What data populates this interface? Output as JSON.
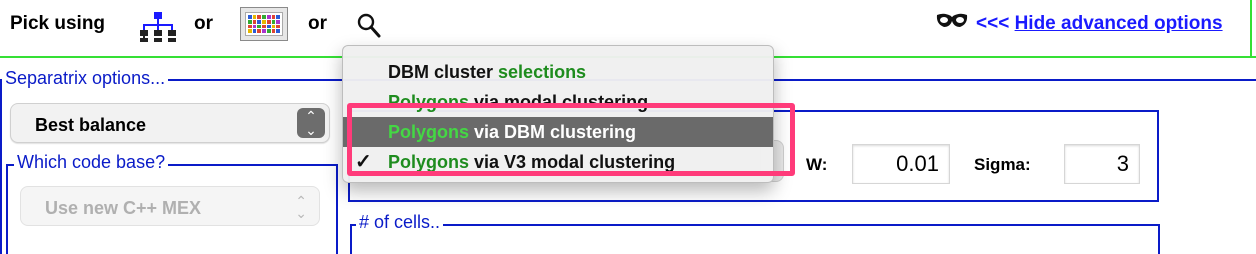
{
  "top": {
    "pick_using": "Pick using",
    "or1": "or",
    "or2": "or",
    "hide_prefix": "<<< ",
    "hide_link": "Hide advanced options",
    "icons": [
      "tree-icon",
      "grid-icon",
      "magnifier-icon",
      "mask-icon"
    ]
  },
  "separatrix": {
    "legend": "Separatrix options...",
    "selected": "Best balance"
  },
  "codebase": {
    "legend": "Which code base?",
    "selected": "Use new C++ MEX"
  },
  "cells": {
    "legend": "# of cells.."
  },
  "params": {
    "w_label": "W:",
    "w_value": "0.01",
    "sigma_label": "Sigma:",
    "sigma_value": "3"
  },
  "menu": {
    "items": [
      {
        "plain": "DBM cluster ",
        "green": "selections",
        "green_first": false,
        "selected": false,
        "checked": false
      },
      {
        "green": "Polygons",
        "plain": " via modal clustering",
        "green_first": true,
        "selected": false,
        "checked": false
      },
      {
        "green": "Polygons",
        "plain": " via DBM clustering",
        "green_first": true,
        "selected": true,
        "checked": false
      },
      {
        "green": "Polygons",
        "plain": " via V3 modal clustering",
        "green_first": true,
        "selected": false,
        "checked": true
      }
    ],
    "checkmark": "✓"
  },
  "colors": {
    "accent_green": "#35e035",
    "panel_blue": "#0a1bc8",
    "link_blue": "#1a1aff",
    "menu_green": "#1e8c1e",
    "highlight": "#ff3b7a"
  }
}
